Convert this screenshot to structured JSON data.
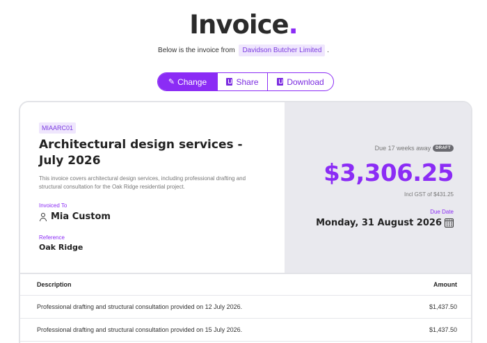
{
  "header": {
    "title": "Invoice",
    "title_dot": ".",
    "subtitle_prefix": "Below is the invoice from",
    "sender": "Davidson Butcher Limited",
    "subtitle_suffix": "."
  },
  "actions": {
    "change_label": "Change",
    "share_label": "Share",
    "download_label": "Download"
  },
  "invoice": {
    "code": "MIAARC01",
    "title": "Architectural design services - July 2026",
    "description": "This invoice covers architectural design services, including professional drafting and structural consultation for the Oak Ridge residential project.",
    "invoiced_to_label": "Invoiced To",
    "invoiced_to": "Mia Custom",
    "reference_label": "Reference",
    "reference": "Oak Ridge",
    "due_away": "Due 17 weeks away",
    "status": "DRAFT",
    "amount": "$3,306.25",
    "gst": "Incl GST of $431.25",
    "due_date_label": "Due Date",
    "due_date": "Monday, 31 August 2026"
  },
  "table": {
    "headers": {
      "description": "Description",
      "amount": "Amount"
    },
    "rows": [
      {
        "description": "Professional drafting and structural consultation provided on 12 July 2026.",
        "amount": "$1,437.50"
      },
      {
        "description": "Professional drafting and structural consultation provided on 15 July 2026.",
        "amount": "$1,437.50"
      }
    ]
  },
  "colors": {
    "accent": "#8b2cf5",
    "accent_light": "#efe6fd",
    "right_pane_bg": "#e9e9ee"
  },
  "icons": [
    "pencil-icon",
    "share-icon",
    "download-icon",
    "user-icon",
    "calendar-icon"
  ]
}
